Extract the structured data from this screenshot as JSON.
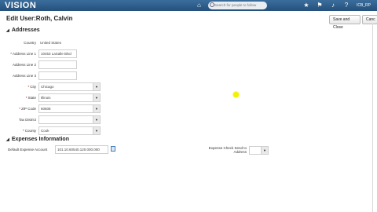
{
  "header": {
    "logo": "VISION",
    "search_placeholder": "Search for people to follow",
    "user": "ICB_RP"
  },
  "page": {
    "title": "Edit User:Roth, Calvin",
    "save_close": "Save and Close",
    "cancel": "Canc"
  },
  "addresses": {
    "heading": "Addresses",
    "country_label": "Country",
    "country_value": "United States",
    "addr1_label": "Address Line 1",
    "addr1_value": "10453 LaSalle Blvd",
    "addr2_label": "Address Line 2",
    "addr2_value": "",
    "addr3_label": "Address Line 3",
    "addr3_value": "",
    "city_label": "City",
    "city_value": "Chicago",
    "state_label": "State",
    "state_value": "Illinois",
    "zip_label": "ZIP Code",
    "zip_value": "60608",
    "tax_label": "Tax District",
    "tax_value": "",
    "county_label": "County",
    "county_value": "Cook"
  },
  "expenses": {
    "heading": "Expenses Information",
    "account_label": "Default Expense Account",
    "account_value": "101.10.60540.120.000.000",
    "check_label_1": "Expense Check Send to",
    "check_label_2": "Address",
    "check_value": ""
  },
  "colors": {
    "topbar": "#2f5f8f",
    "required": "#aa0000"
  },
  "icons": [
    "home-icon",
    "star-icon",
    "flag-icon",
    "bell-icon",
    "help-icon",
    "search-icon",
    "calculator-icon"
  ]
}
